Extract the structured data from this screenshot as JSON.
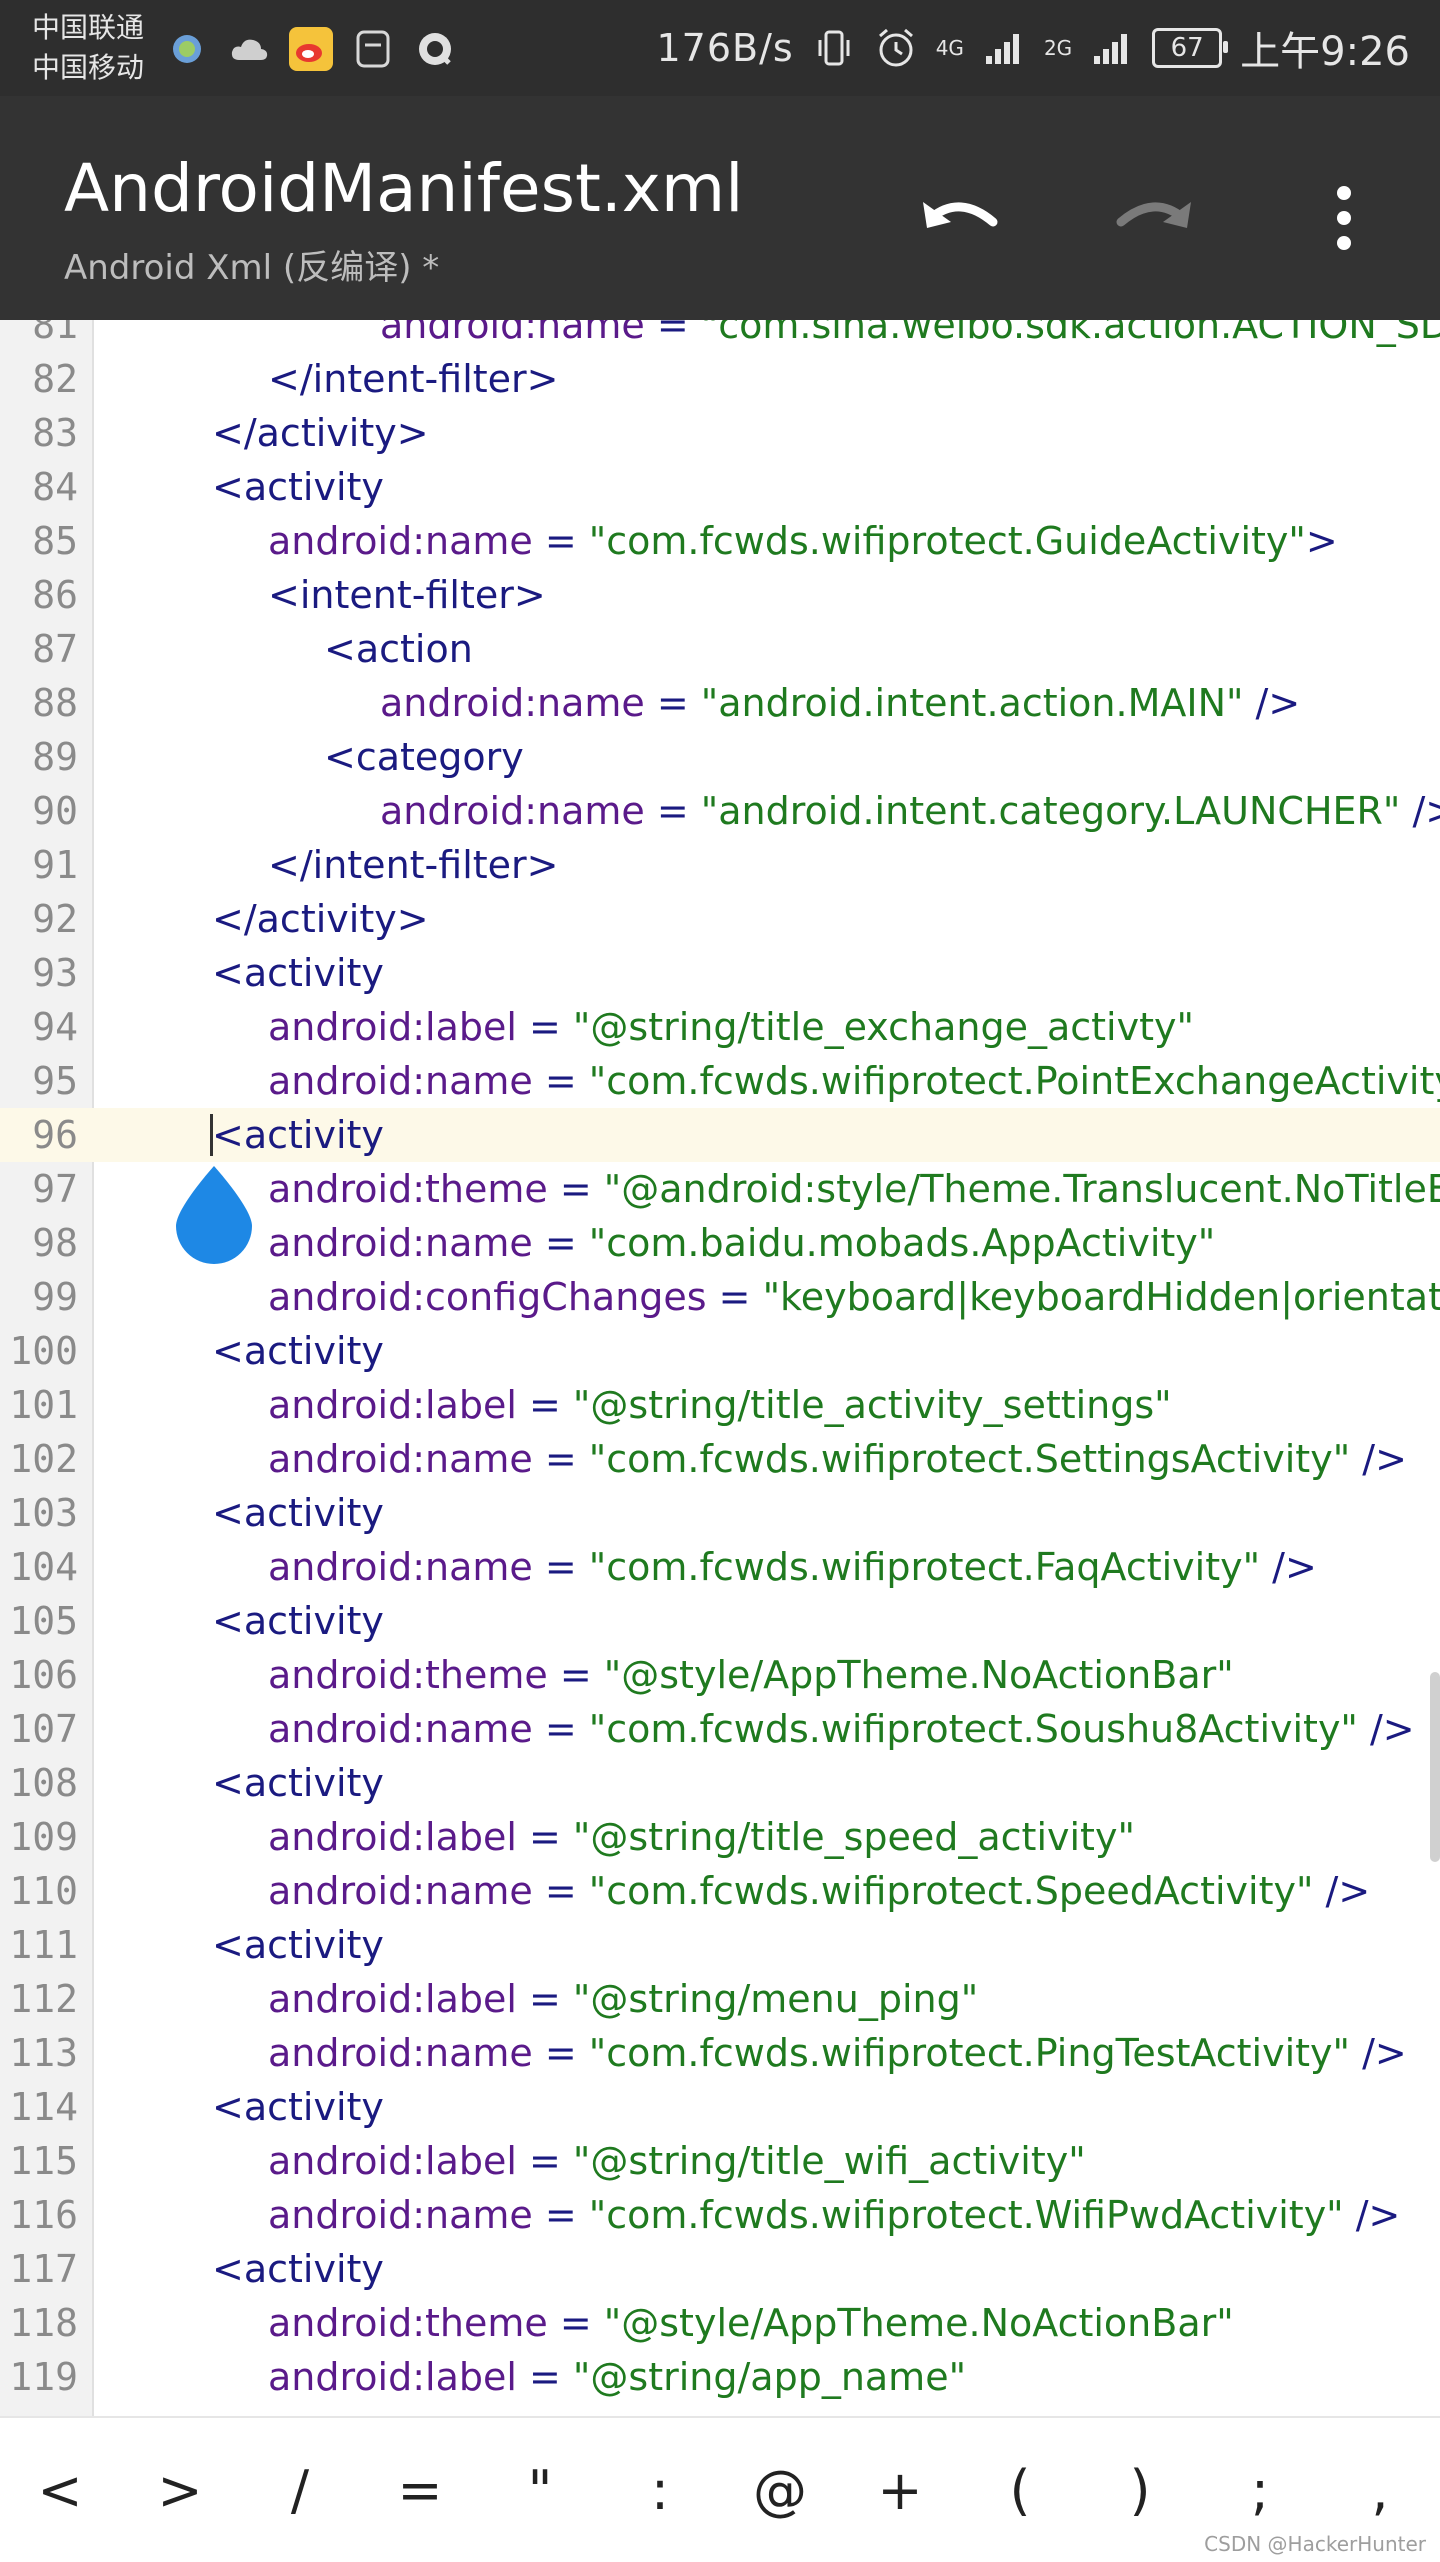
{
  "status_bar": {
    "carrier1": "中国联通",
    "carrier2": "中国移动",
    "speed": "176B/s",
    "net1": "4G",
    "net2": "2G",
    "battery": "67",
    "time": "上午9:26"
  },
  "toolbar": {
    "title": "AndroidManifest.xml",
    "subtitle": "Android Xml (反编译) *"
  },
  "editor": {
    "current_line": "96",
    "lines": [
      {
        "n": "81",
        "indent": 5,
        "tokens": [
          {
            "t": "attr",
            "v": "android:name"
          },
          {
            "t": "eq",
            "v": " = "
          },
          {
            "t": "val",
            "v": "\"com.sina.weibo.sdk.action.ACTION_SDK_REQ"
          }
        ]
      },
      {
        "n": "82",
        "indent": 3,
        "tokens": [
          {
            "t": "tag",
            "v": "</intent-filter>"
          }
        ]
      },
      {
        "n": "83",
        "indent": 2,
        "tokens": [
          {
            "t": "tag",
            "v": "</activity>"
          }
        ]
      },
      {
        "n": "84",
        "indent": 2,
        "tokens": [
          {
            "t": "tag",
            "v": "<activity"
          }
        ]
      },
      {
        "n": "85",
        "indent": 3,
        "tokens": [
          {
            "t": "attr",
            "v": "android:name"
          },
          {
            "t": "eq",
            "v": " = "
          },
          {
            "t": "val",
            "v": "\"com.fcwds.wifiprotect.GuideActivity\""
          },
          {
            "t": "tag",
            "v": ">"
          }
        ]
      },
      {
        "n": "86",
        "indent": 3,
        "tokens": [
          {
            "t": "tag",
            "v": "<intent-filter>"
          }
        ]
      },
      {
        "n": "87",
        "indent": 4,
        "tokens": [
          {
            "t": "tag",
            "v": "<action"
          }
        ]
      },
      {
        "n": "88",
        "indent": 5,
        "tokens": [
          {
            "t": "attr",
            "v": "android:name"
          },
          {
            "t": "eq",
            "v": " = "
          },
          {
            "t": "val",
            "v": "\"android.intent.action.MAIN\""
          },
          {
            "t": "tag",
            "v": " />"
          }
        ]
      },
      {
        "n": "89",
        "indent": 4,
        "tokens": [
          {
            "t": "tag",
            "v": "<category"
          }
        ]
      },
      {
        "n": "90",
        "indent": 5,
        "tokens": [
          {
            "t": "attr",
            "v": "android:name"
          },
          {
            "t": "eq",
            "v": " = "
          },
          {
            "t": "val",
            "v": "\"android.intent.category.LAUNCHER\""
          },
          {
            "t": "tag",
            "v": " />"
          }
        ]
      },
      {
        "n": "91",
        "indent": 3,
        "tokens": [
          {
            "t": "tag",
            "v": "</intent-filter>"
          }
        ]
      },
      {
        "n": "92",
        "indent": 2,
        "tokens": [
          {
            "t": "tag",
            "v": "</activity>"
          }
        ]
      },
      {
        "n": "93",
        "indent": 2,
        "tokens": [
          {
            "t": "tag",
            "v": "<activity"
          }
        ]
      },
      {
        "n": "94",
        "indent": 3,
        "tokens": [
          {
            "t": "attr",
            "v": "android:label"
          },
          {
            "t": "eq",
            "v": " = "
          },
          {
            "t": "val",
            "v": "\"@string/title_exchange_activty\""
          }
        ]
      },
      {
        "n": "95",
        "indent": 3,
        "tokens": [
          {
            "t": "attr",
            "v": "android:name"
          },
          {
            "t": "eq",
            "v": " = "
          },
          {
            "t": "val",
            "v": "\"com.fcwds.wifiprotect.PointExchangeActivity\""
          },
          {
            "t": "tag",
            "v": " />"
          }
        ]
      },
      {
        "n": "96",
        "indent": 2,
        "tokens": [
          {
            "t": "tag",
            "v": "<activity"
          }
        ]
      },
      {
        "n": "97",
        "indent": 3,
        "tokens": [
          {
            "t": "attr",
            "v": "android:theme"
          },
          {
            "t": "eq",
            "v": " = "
          },
          {
            "t": "val",
            "v": "\"@android:style/Theme.Translucent.NoTitleBar\""
          }
        ]
      },
      {
        "n": "98",
        "indent": 3,
        "tokens": [
          {
            "t": "attr",
            "v": "android:name"
          },
          {
            "t": "eq",
            "v": " = "
          },
          {
            "t": "val",
            "v": "\"com.baidu.mobads.AppActivity\""
          }
        ]
      },
      {
        "n": "99",
        "indent": 3,
        "tokens": [
          {
            "t": "attr",
            "v": "android:configChanges"
          },
          {
            "t": "eq",
            "v": " = "
          },
          {
            "t": "val",
            "v": "\"keyboard|keyboardHidden|orientation\""
          },
          {
            "t": "tag",
            "v": " />"
          }
        ]
      },
      {
        "n": "100",
        "indent": 2,
        "tokens": [
          {
            "t": "tag",
            "v": "<activity"
          }
        ]
      },
      {
        "n": "101",
        "indent": 3,
        "tokens": [
          {
            "t": "attr",
            "v": "android:label"
          },
          {
            "t": "eq",
            "v": " = "
          },
          {
            "t": "val",
            "v": "\"@string/title_activity_settings\""
          }
        ]
      },
      {
        "n": "102",
        "indent": 3,
        "tokens": [
          {
            "t": "attr",
            "v": "android:name"
          },
          {
            "t": "eq",
            "v": " = "
          },
          {
            "t": "val",
            "v": "\"com.fcwds.wifiprotect.SettingsActivity\""
          },
          {
            "t": "tag",
            "v": " />"
          }
        ]
      },
      {
        "n": "103",
        "indent": 2,
        "tokens": [
          {
            "t": "tag",
            "v": "<activity"
          }
        ]
      },
      {
        "n": "104",
        "indent": 3,
        "tokens": [
          {
            "t": "attr",
            "v": "android:name"
          },
          {
            "t": "eq",
            "v": " = "
          },
          {
            "t": "val",
            "v": "\"com.fcwds.wifiprotect.FaqActivity\""
          },
          {
            "t": "tag",
            "v": " />"
          }
        ]
      },
      {
        "n": "105",
        "indent": 2,
        "tokens": [
          {
            "t": "tag",
            "v": "<activity"
          }
        ]
      },
      {
        "n": "106",
        "indent": 3,
        "tokens": [
          {
            "t": "attr",
            "v": "android:theme"
          },
          {
            "t": "eq",
            "v": " = "
          },
          {
            "t": "val",
            "v": "\"@style/AppTheme.NoActionBar\""
          }
        ]
      },
      {
        "n": "107",
        "indent": 3,
        "tokens": [
          {
            "t": "attr",
            "v": "android:name"
          },
          {
            "t": "eq",
            "v": " = "
          },
          {
            "t": "val",
            "v": "\"com.fcwds.wifiprotect.Soushu8Activity\""
          },
          {
            "t": "tag",
            "v": " />"
          }
        ]
      },
      {
        "n": "108",
        "indent": 2,
        "tokens": [
          {
            "t": "tag",
            "v": "<activity"
          }
        ]
      },
      {
        "n": "109",
        "indent": 3,
        "tokens": [
          {
            "t": "attr",
            "v": "android:label"
          },
          {
            "t": "eq",
            "v": " = "
          },
          {
            "t": "val",
            "v": "\"@string/title_speed_activity\""
          }
        ]
      },
      {
        "n": "110",
        "indent": 3,
        "tokens": [
          {
            "t": "attr",
            "v": "android:name"
          },
          {
            "t": "eq",
            "v": " = "
          },
          {
            "t": "val",
            "v": "\"com.fcwds.wifiprotect.SpeedActivity\""
          },
          {
            "t": "tag",
            "v": " />"
          }
        ]
      },
      {
        "n": "111",
        "indent": 2,
        "tokens": [
          {
            "t": "tag",
            "v": "<activity"
          }
        ]
      },
      {
        "n": "112",
        "indent": 3,
        "tokens": [
          {
            "t": "attr",
            "v": "android:label"
          },
          {
            "t": "eq",
            "v": " = "
          },
          {
            "t": "val",
            "v": "\"@string/menu_ping\""
          }
        ]
      },
      {
        "n": "113",
        "indent": 3,
        "tokens": [
          {
            "t": "attr",
            "v": "android:name"
          },
          {
            "t": "eq",
            "v": " = "
          },
          {
            "t": "val",
            "v": "\"com.fcwds.wifiprotect.PingTestActivity\""
          },
          {
            "t": "tag",
            "v": " />"
          }
        ]
      },
      {
        "n": "114",
        "indent": 2,
        "tokens": [
          {
            "t": "tag",
            "v": "<activity"
          }
        ]
      },
      {
        "n": "115",
        "indent": 3,
        "tokens": [
          {
            "t": "attr",
            "v": "android:label"
          },
          {
            "t": "eq",
            "v": " = "
          },
          {
            "t": "val",
            "v": "\"@string/title_wifi_activity\""
          }
        ]
      },
      {
        "n": "116",
        "indent": 3,
        "tokens": [
          {
            "t": "attr",
            "v": "android:name"
          },
          {
            "t": "eq",
            "v": " = "
          },
          {
            "t": "val",
            "v": "\"com.fcwds.wifiprotect.WifiPwdActivity\""
          },
          {
            "t": "tag",
            "v": " />"
          }
        ]
      },
      {
        "n": "117",
        "indent": 2,
        "tokens": [
          {
            "t": "tag",
            "v": "<activity"
          }
        ]
      },
      {
        "n": "118",
        "indent": 3,
        "tokens": [
          {
            "t": "attr",
            "v": "android:theme"
          },
          {
            "t": "eq",
            "v": " = "
          },
          {
            "t": "val",
            "v": "\"@style/AppTheme.NoActionBar\""
          }
        ]
      },
      {
        "n": "119",
        "indent": 3,
        "tokens": [
          {
            "t": "attr",
            "v": "android:label"
          },
          {
            "t": "eq",
            "v": " = "
          },
          {
            "t": "val",
            "v": "\"@string/app_name\""
          }
        ]
      }
    ]
  },
  "symbols": [
    "<",
    ">",
    "/",
    "=",
    "\"",
    ":",
    "@",
    "+",
    "(",
    ")",
    ";",
    ","
  ],
  "watermark": "CSDN @HackerHunter",
  "colors": {
    "tag": "#1a1a80",
    "attr": "#5a1a8a",
    "value": "#1f7a1f",
    "drop_handle": "#1e88e5",
    "toolbar": "#333333"
  }
}
